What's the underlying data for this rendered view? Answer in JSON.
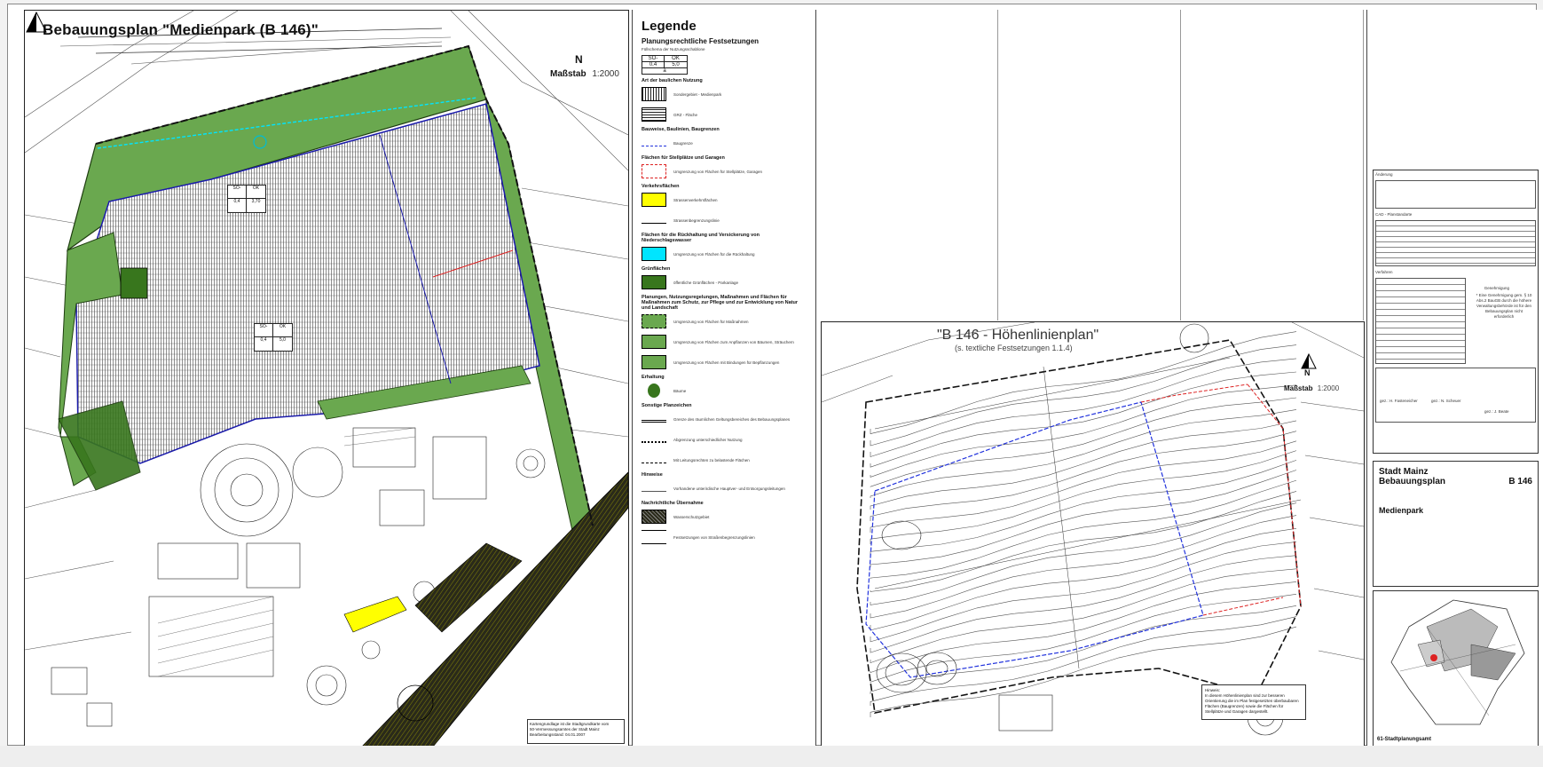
{
  "main_plan": {
    "title": "Bebauungsplan \"Medienpark (B 146)\"",
    "north_label": "N",
    "scale_label": "Maßstab",
    "scale_value": "1:2000",
    "stamp_line1": "Kartengrundlage ist die Stadtgrundkarte vom",
    "stamp_line2": "50-Vermessungsamtes der Stadt Mainz",
    "stamp_line3": "Bearbeitungsstand: 04.01.2007",
    "nutz_tables": [
      {
        "type": "SO-",
        "gfz_label": "OK",
        "gfz": "0,4",
        "ok": "3,70"
      },
      {
        "type": "SO-",
        "gfz_label": "OK",
        "gfz": "0,4",
        "ok": "5,0"
      }
    ]
  },
  "legend": {
    "title": "Legende",
    "section1": "Planungsrechtliche Festsetzungen",
    "section1_sub": "Füllschema der Nutzungsschablone",
    "matrix": {
      "r1c1": "SO-",
      "r1c2": "OK",
      "r2c1": "0,4",
      "r2c2": "5,0",
      "r3": "a"
    },
    "items": [
      {
        "section": "Art der baulichen Nutzung",
        "text": "Sondergebiet - Medienpark"
      },
      {
        "section": "",
        "text": "GRZ - Fläche"
      },
      {
        "section": "Bauweise, Baulinien, Baugrenzen",
        "text": "Baugrenze"
      },
      {
        "section": "Flächen für Stellplätze und Garagen",
        "text": "Umgrenzung von Flächen für Stellplätze, Garagen"
      },
      {
        "section": "Verkehrsflächen",
        "text": "Strassenverkehrsflächen"
      },
      {
        "section": "",
        "text": "Strassenbegrenzungslinie"
      },
      {
        "section": "Flächen für die Rückhaltung und Versickerung von Niederschlagswasser",
        "text": "Umgrenzung von Flächen für die Rückhaltung"
      },
      {
        "section": "Grünflächen",
        "text": "öffentliche Grünflächen - Parkanlage"
      },
      {
        "section": "Planungen, Nutzungsregelungen, Maßnahmen und Flächen für Maßnahmen zum Schutz, zur Pflege und zur Entwicklung von Natur und Landschaft",
        "text": "Umgrenzung von Flächen für Maßnahmen"
      },
      {
        "section": "",
        "text": "Umgrenzung von Flächen zum Anpflanzen von Bäumen, Sträuchern"
      },
      {
        "section": "",
        "text": "Umgrenzung von Flächen mit Bindungen für Bepflanzungen"
      },
      {
        "section": "Erhaltung",
        "text": "Bäume"
      },
      {
        "section": "Sonstige Planzeichen",
        "text": "Grenze des räumlichen Geltungsbereiches des Bebauungsplanes"
      },
      {
        "section": "",
        "text": "Abgrenzung unterschiedlicher Nutzung"
      },
      {
        "section": "",
        "text": "Mit Leitungsrechten zu belastende Flächen"
      },
      {
        "section": "Hinweise",
        "text": "Vorhandene unterirdische Hauptver- und Entsorgungsleitungen"
      },
      {
        "section": "Nachrichtliche Übernahme",
        "text": "Wasserschutzgebiet"
      },
      {
        "section": "",
        "text": "Festsetzungen von Straßenbegrenzungslinien"
      }
    ]
  },
  "height_plan": {
    "title": "\"B 146 - Höhenlinienplan\"",
    "subtitle": "(s. textliche Festsetzungen 1.1.4)",
    "north_label": "N",
    "scale_label": "Maßstab",
    "scale_value": "1:2000",
    "hinweis_title": "Hinweis:",
    "hinweis_text": "In diesem Höhenlinienplan sind zur besseren Orientierung die im Plan festgesetzten überbaubaren Flächen (Baugrenzen) sowie die Flächen für Stellplätze und Garagen dargestellt."
  },
  "title_block": {
    "city": "Stadt Mainz",
    "plan_type": "Bebauungsplan",
    "plan_no": "B 146",
    "project": "Medienpark",
    "department": "61-Stadtplanungsamt",
    "approval_note": "* Eine Genehmigung gem. § 10 Abs.2 BauGB durch die höhere Verwaltungsbehörde ist für den Bebauungsplan nicht erforderlich",
    "approval_title": "Genehmigung",
    "changes_title": "Änderung",
    "cad_title": "CAD - Planstandarte",
    "verfahren_title": "Verfahren",
    "sign1": "gez.: H. Fasteneicher",
    "sign2": "gez.: N. Scheuer",
    "sign3": "gez.: J. Beate"
  },
  "colors": {
    "green_area": "#6aa84f",
    "green_dark": "#38761d",
    "road_yellow": "#ffff00",
    "cyan_line": "#00e5ff",
    "boundary_blue": "#2233dd",
    "red_line": "#dd2222"
  }
}
